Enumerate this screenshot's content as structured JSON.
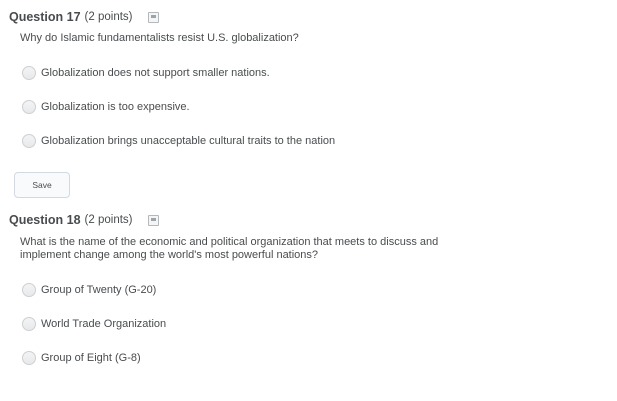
{
  "questions": [
    {
      "title": "Question 17",
      "points": "(2 points)",
      "prompt": "Why do Islamic fundamentalists resist U.S. globalization?",
      "options": [
        "Globalization does not support smaller nations.",
        "Globalization is too expensive.",
        "Globalization brings unacceptable cultural traits to the nation"
      ]
    },
    {
      "title": "Question 18",
      "points": "(2 points)",
      "prompt": "What is the name of the economic and political organization that meets to discuss and implement change among the world's most powerful nations?",
      "options": [
        "Group of Twenty (G-20)",
        "World Trade Organization",
        "Group of Eight (G-8)"
      ]
    }
  ],
  "save_label": "Save",
  "icons": {
    "flag": "bookmark-flag-icon",
    "radio": "radio-unselected"
  }
}
